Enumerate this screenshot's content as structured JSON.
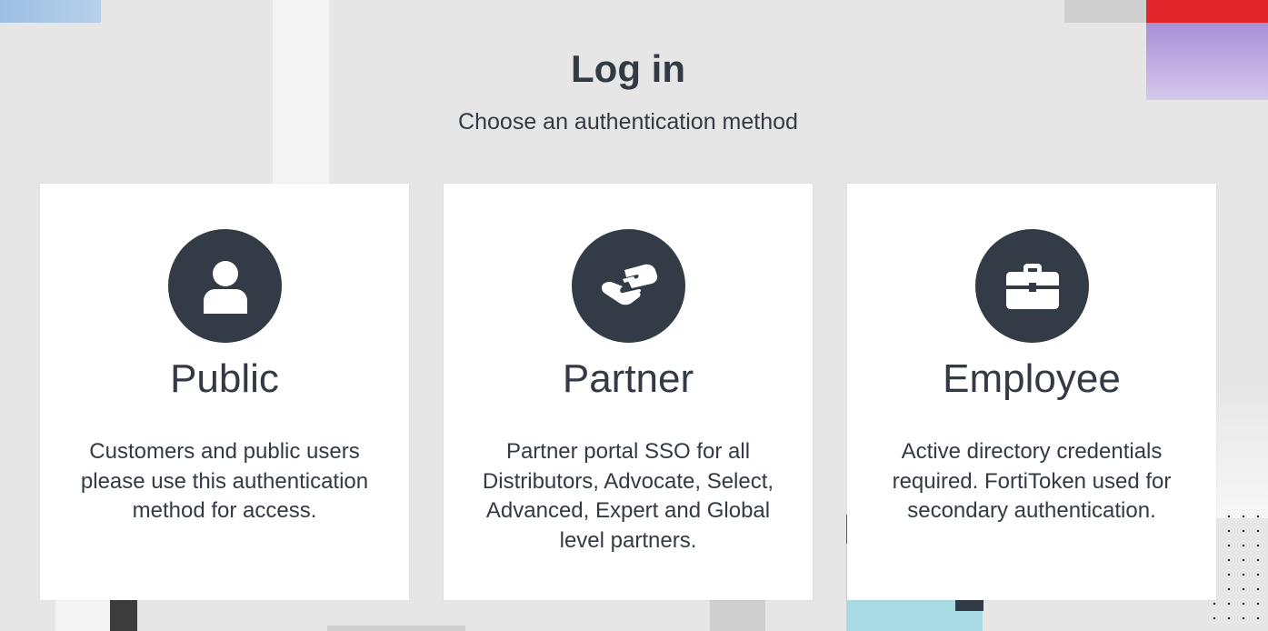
{
  "header": {
    "title": "Log in",
    "subtitle": "Choose an authentication method"
  },
  "options": [
    {
      "title": "Public",
      "description": "Customers and public users please use this authentication method for access.",
      "icon": "user-icon"
    },
    {
      "title": "Partner",
      "description": "Partner portal SSO for all Distributors, Advocate, Select, Advanced, Expert and Global level partners.",
      "icon": "handshake-icon"
    },
    {
      "title": "Employee",
      "description": "Active directory credentials required. FortiToken used for secondary authentication.",
      "icon": "briefcase-icon"
    }
  ],
  "colors": {
    "background": "#e6e6e6",
    "card": "#ffffff",
    "icon_circle": "#323b46",
    "text": "#333a44",
    "accent_red": "#e1262b"
  }
}
